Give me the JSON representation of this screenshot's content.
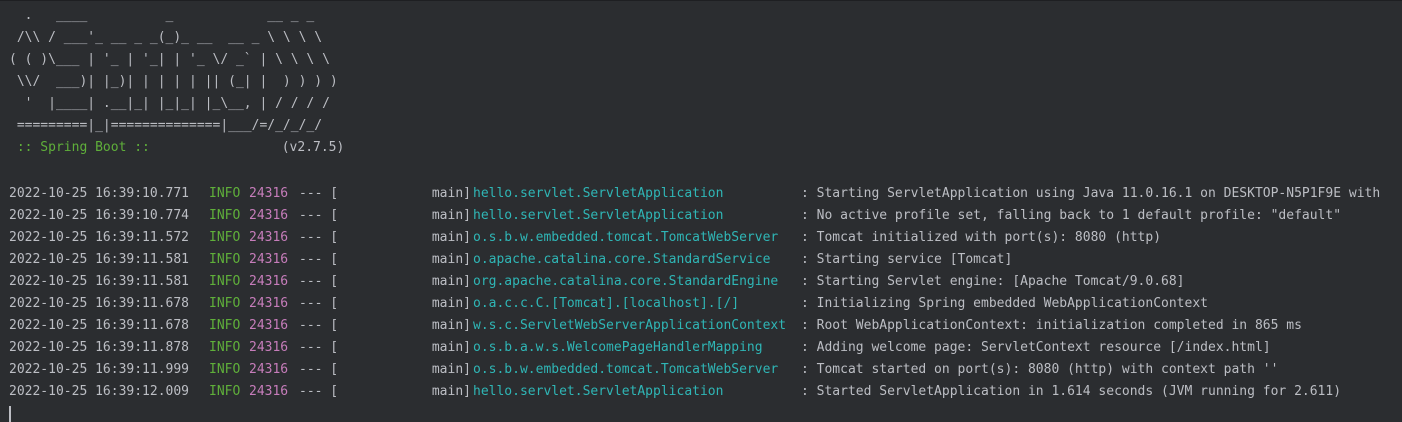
{
  "banner": {
    "lines": [
      "  .   ____          _            __ _ _",
      " /\\\\ / ___'_ __ _ _(_)_ __  __ _ \\ \\ \\ \\",
      "( ( )\\___ | '_ | '_| | '_ \\/ _` | \\ \\ \\ \\",
      " \\\\/  ___)| |_)| | | | | || (_| |  ) ) ) )",
      "  '  |____| .__|_| |_|_| |_\\__, | / / / /",
      " =========|_|==============|___/=/_/_/_/"
    ],
    "spring_label": " :: Spring Boot :: ",
    "spring_version": "(v2.7.5)"
  },
  "log": {
    "rows": [
      {
        "ts": "2022-10-25 16:39:10.771",
        "level": "INFO",
        "pid": "24316",
        "sep": "--- [",
        "thread": "main]",
        "logger": "hello.servlet.ServletApplication",
        "msg": ": Starting ServletApplication using Java 11.0.16.1 on DESKTOP-N5P1F9E with"
      },
      {
        "ts": "2022-10-25 16:39:10.774",
        "level": "INFO",
        "pid": "24316",
        "sep": "--- [",
        "thread": "main]",
        "logger": "hello.servlet.ServletApplication",
        "msg": ": No active profile set, falling back to 1 default profile: \"default\""
      },
      {
        "ts": "2022-10-25 16:39:11.572",
        "level": "INFO",
        "pid": "24316",
        "sep": "--- [",
        "thread": "main]",
        "logger": "o.s.b.w.embedded.tomcat.TomcatWebServer",
        "msg": ": Tomcat initialized with port(s): 8080 (http)"
      },
      {
        "ts": "2022-10-25 16:39:11.581",
        "level": "INFO",
        "pid": "24316",
        "sep": "--- [",
        "thread": "main]",
        "logger": "o.apache.catalina.core.StandardService",
        "msg": ": Starting service [Tomcat]"
      },
      {
        "ts": "2022-10-25 16:39:11.581",
        "level": "INFO",
        "pid": "24316",
        "sep": "--- [",
        "thread": "main]",
        "logger": "org.apache.catalina.core.StandardEngine",
        "msg": ": Starting Servlet engine: [Apache Tomcat/9.0.68]"
      },
      {
        "ts": "2022-10-25 16:39:11.678",
        "level": "INFO",
        "pid": "24316",
        "sep": "--- [",
        "thread": "main]",
        "logger": "o.a.c.c.C.[Tomcat].[localhost].[/]",
        "msg": ": Initializing Spring embedded WebApplicationContext"
      },
      {
        "ts": "2022-10-25 16:39:11.678",
        "level": "INFO",
        "pid": "24316",
        "sep": "--- [",
        "thread": "main]",
        "logger": "w.s.c.ServletWebServerApplicationContext",
        "msg": ": Root WebApplicationContext: initialization completed in 865 ms"
      },
      {
        "ts": "2022-10-25 16:39:11.878",
        "level": "INFO",
        "pid": "24316",
        "sep": "--- [",
        "thread": "main]",
        "logger": "o.s.b.a.w.s.WelcomePageHandlerMapping",
        "msg": ": Adding welcome page: ServletContext resource [/index.html]"
      },
      {
        "ts": "2022-10-25 16:39:11.999",
        "level": "INFO",
        "pid": "24316",
        "sep": "--- [",
        "thread": "main]",
        "logger": "o.s.b.w.embedded.tomcat.TomcatWebServer",
        "msg": ": Tomcat started on port(s): 8080 (http) with context path ''"
      },
      {
        "ts": "2022-10-25 16:39:12.009",
        "level": "INFO",
        "pid": "24316",
        "sep": "--- [",
        "thread": "main]",
        "logger": "hello.servlet.ServletApplication",
        "msg": ": Started ServletApplication in 1.614 seconds (JVM running for 2.611)"
      }
    ]
  },
  "colors": {
    "background": "#2b2d30",
    "text": "#bcbec4",
    "level_info": "#5faf3a",
    "pid": "#c77dbb",
    "logger": "#2fb6b6"
  }
}
